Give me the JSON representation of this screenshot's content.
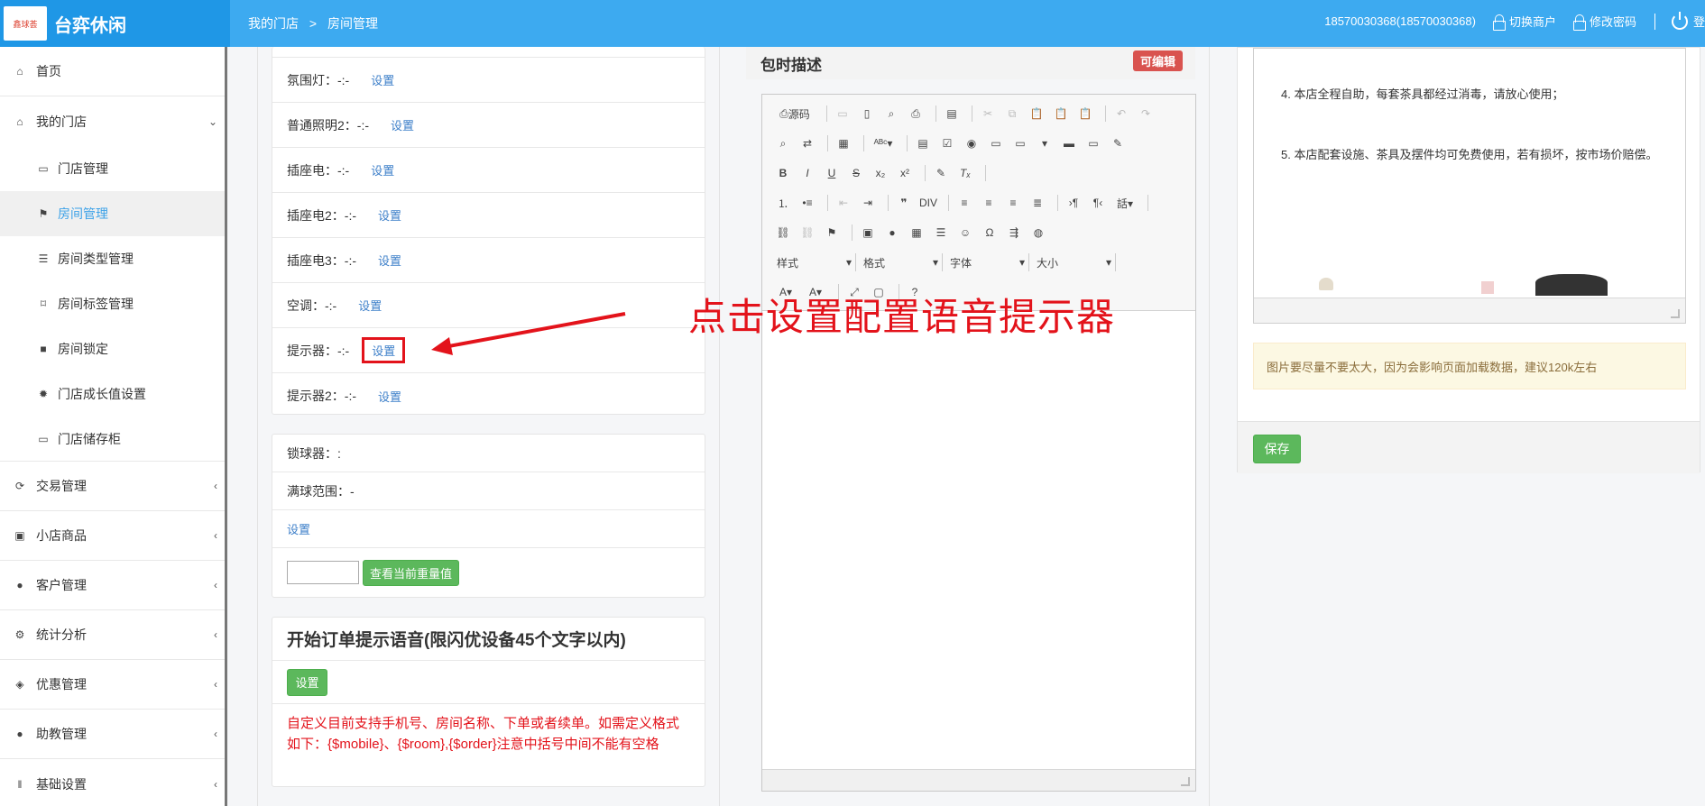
{
  "brand": {
    "logo_text": "鑫球荟",
    "name": "台弈休闲"
  },
  "breadcrumb": {
    "parent": "我的门店",
    "separator": ">",
    "current": "房间管理"
  },
  "topbar": {
    "user": "18570030368(18570030368)",
    "switch_merchant": "切换商户",
    "change_password": "修改密码",
    "logout": "登"
  },
  "sidebar": {
    "home": "首页",
    "my_store": "我的门店",
    "sub_items": [
      "门店管理",
      "房间管理",
      "房间类型管理",
      "房间标签管理",
      "房间锁定",
      "门店成长值设置",
      "门店储存柜"
    ],
    "groups": [
      "交易管理",
      "小店商品",
      "客户管理",
      "统计分析",
      "优惠管理",
      "助教管理",
      "基础设置"
    ]
  },
  "devices": {
    "rows": [
      {
        "label": "氛围灯：-:-",
        "action": "设置"
      },
      {
        "label": "普通照明2：-:-",
        "action": "设置"
      },
      {
        "label": "插座电：-:-",
        "action": "设置"
      },
      {
        "label": "插座电2：-:-",
        "action": "设置"
      },
      {
        "label": "插座电3：-:-",
        "action": "设置"
      },
      {
        "label": "空调：-:-",
        "action": "设置"
      },
      {
        "label": "提示器：-:-",
        "action": "设置"
      },
      {
        "label": "提示器2：-:-",
        "action": "设置"
      }
    ]
  },
  "ball_lock": {
    "lock_label": "锁球器：:",
    "range_label": "满球范围：-",
    "set_link": "设置",
    "weight_input": "",
    "check_button": "查看当前重量值"
  },
  "order_voice": {
    "title": "开始订单提示语音(限闪优设备45个文字以内)",
    "set_button": "设置",
    "hint": "自定义目前支持手机号、房间名称、下单或者续单。如需定义格式如下：{$mobile}、{$room},{$order}注意中括号中间不能有空格"
  },
  "editor": {
    "title": "包时描述",
    "badge": "可编辑",
    "source_label": "源码",
    "combos": [
      "样式",
      "格式",
      "字体",
      "大小"
    ]
  },
  "preview": {
    "line4": "4. 本店全程自助，每套茶具都经过消毒，请放心使用；",
    "line5": "5. 本店配套设施、茶具及摆件均可免费使用，若有损坏，按市场价赔偿。"
  },
  "warning": "图片要尽量不要太大，因为会影响页面加载数据，建议120k左右",
  "save_button": "保存",
  "annotation": "点击设置配置语音提示器",
  "colors": {
    "topbar": "#3daaf0",
    "accent": "#3d7fc9",
    "success": "#5cb85c",
    "danger": "#e3131b"
  }
}
